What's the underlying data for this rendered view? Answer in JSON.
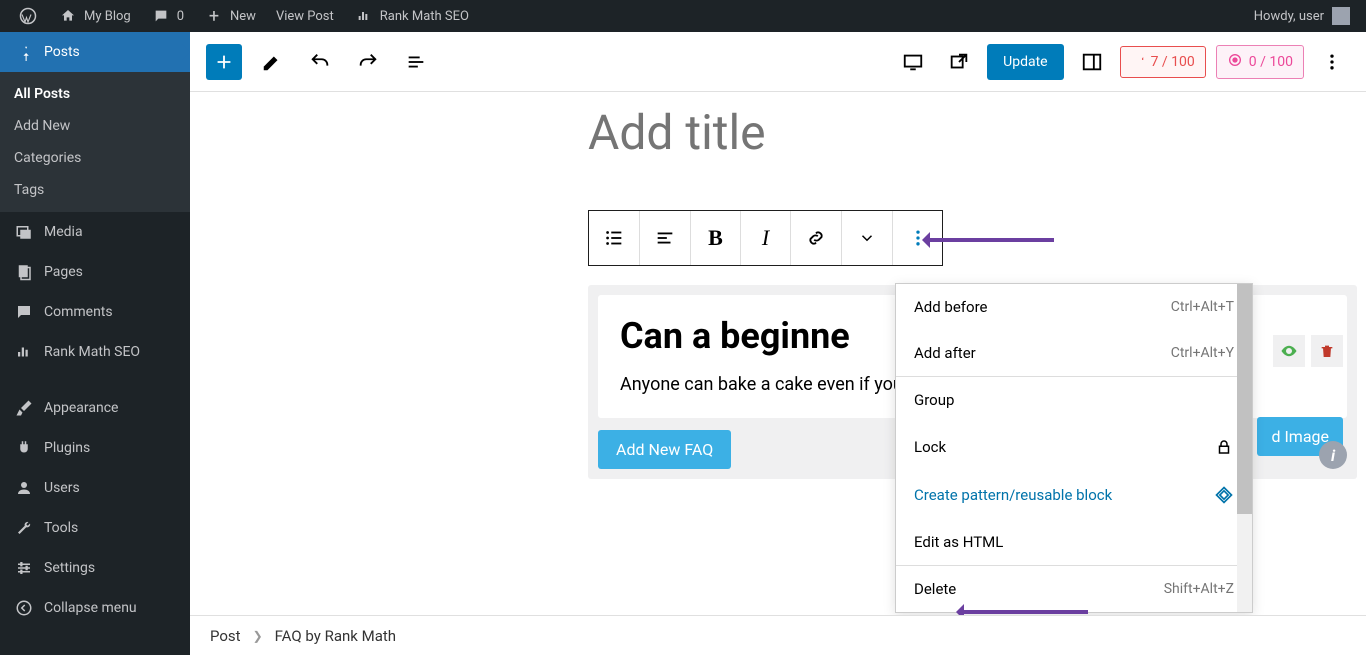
{
  "adminbar": {
    "site": "My Blog",
    "comments": "0",
    "new": "New",
    "view": "View Post",
    "seo": "Rank Math SEO",
    "howdy": "Howdy, user"
  },
  "sidebar": {
    "posts": "Posts",
    "all_posts": "All Posts",
    "add_new": "Add New",
    "categories": "Categories",
    "tags": "Tags",
    "media": "Media",
    "pages": "Pages",
    "comments": "Comments",
    "rankmath": "Rank Math SEO",
    "appearance": "Appearance",
    "plugins": "Plugins",
    "users": "Users",
    "tools": "Tools",
    "settings": "Settings",
    "collapse": "Collapse menu"
  },
  "toolbar": {
    "update": "Update",
    "score1": "7 / 100",
    "score2": "0 / 100"
  },
  "editor": {
    "title_placeholder": "Add title",
    "faq_question": "Can a beginne",
    "faq_answer": "Anyone can bake a cake even if you are a complete beginner.",
    "upload_image": "d Image",
    "add_new_faq": "Add New FAQ"
  },
  "dropdown": {
    "add_before": "Add before",
    "add_before_kbd": "Ctrl+Alt+T",
    "add_after": "Add after",
    "add_after_kbd": "Ctrl+Alt+Y",
    "group": "Group",
    "lock": "Lock",
    "create_pattern": "Create pattern/reusable block",
    "edit_html": "Edit as HTML",
    "delete": "Delete",
    "delete_kbd": "Shift+Alt+Z"
  },
  "breadcrumb": {
    "post": "Post",
    "faq": "FAQ by Rank Math"
  }
}
